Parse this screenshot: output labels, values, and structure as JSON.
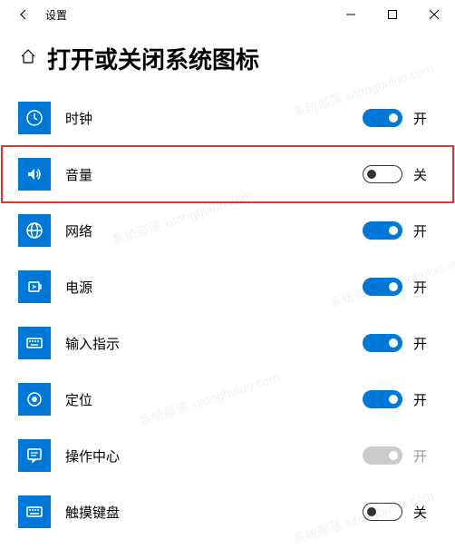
{
  "titlebar": {
    "title": "设置"
  },
  "header": {
    "title": "打开或关闭系统图标"
  },
  "labels": {
    "on": "开",
    "off": "关"
  },
  "rows": [
    {
      "id": "clock",
      "label": "时钟",
      "state": "on",
      "highlight": false
    },
    {
      "id": "volume",
      "label": "音量",
      "state": "off",
      "highlight": true
    },
    {
      "id": "network",
      "label": "网络",
      "state": "on",
      "highlight": false
    },
    {
      "id": "power",
      "label": "电源",
      "state": "on",
      "highlight": false
    },
    {
      "id": "input",
      "label": "输入指示",
      "state": "on",
      "highlight": false
    },
    {
      "id": "location",
      "label": "定位",
      "state": "on",
      "highlight": false
    },
    {
      "id": "actioncenter",
      "label": "操作中心",
      "state": "disabled",
      "highlight": false
    },
    {
      "id": "touchkb",
      "label": "触摸键盘",
      "state": "off",
      "highlight": false
    }
  ],
  "watermark": "系统部落 xitongbuluo.com"
}
